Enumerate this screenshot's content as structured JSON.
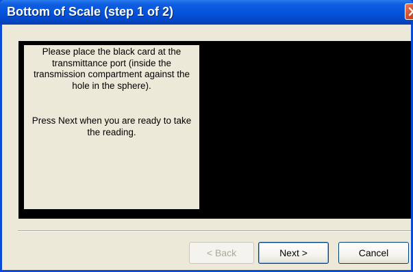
{
  "window": {
    "title": "Bottom of Scale (step 1 of 2)",
    "close_icon": "close-icon"
  },
  "instructions": {
    "paragraph1": "Please place the black card at the transmittance port (inside the transmission compartment against the hole in the sphere).",
    "paragraph2": "Press Next when you are ready to take the reading."
  },
  "buttons": {
    "back_label": "< Back",
    "next_label": "Next >",
    "cancel_label": "Cancel"
  },
  "colors": {
    "title_bar": "#0654dc",
    "client_bg": "#ece9d8",
    "preview_panel": "#000000",
    "close_button": "#d24a24"
  }
}
